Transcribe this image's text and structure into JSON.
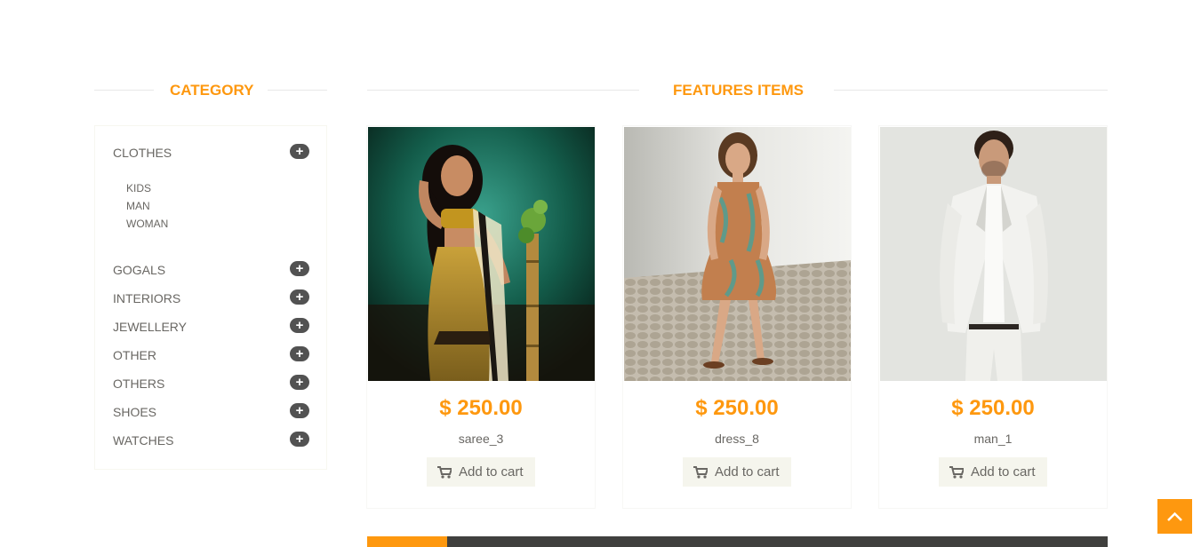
{
  "category": {
    "title": "Category",
    "items": [
      {
        "label": "CLOTHES",
        "expanded": true,
        "children": [
          "KIDS",
          "MAN",
          "WOMAN"
        ]
      },
      {
        "label": "GOGALS"
      },
      {
        "label": "INTERIORS"
      },
      {
        "label": "JEWELLERY"
      },
      {
        "label": "OTHER"
      },
      {
        "label": "OTHERS"
      },
      {
        "label": "SHOES"
      },
      {
        "label": "WATCHES"
      }
    ],
    "expand_icon": "plus-icon"
  },
  "features": {
    "title": "Features Items",
    "products": [
      {
        "price": "$ 250.00",
        "name": "saree_3",
        "cart_label": "Add to cart"
      },
      {
        "price": "$ 250.00",
        "name": "dress_8",
        "cart_label": "Add to cart"
      },
      {
        "price": "$ 250.00",
        "name": "man_1",
        "cart_label": "Add to cart"
      }
    ]
  },
  "colors": {
    "accent": "#fe980f",
    "dark": "#40403e",
    "text": "#696763"
  },
  "icons": {
    "cart": "shopping-cart-icon",
    "scroll_up": "chevron-up-icon"
  }
}
